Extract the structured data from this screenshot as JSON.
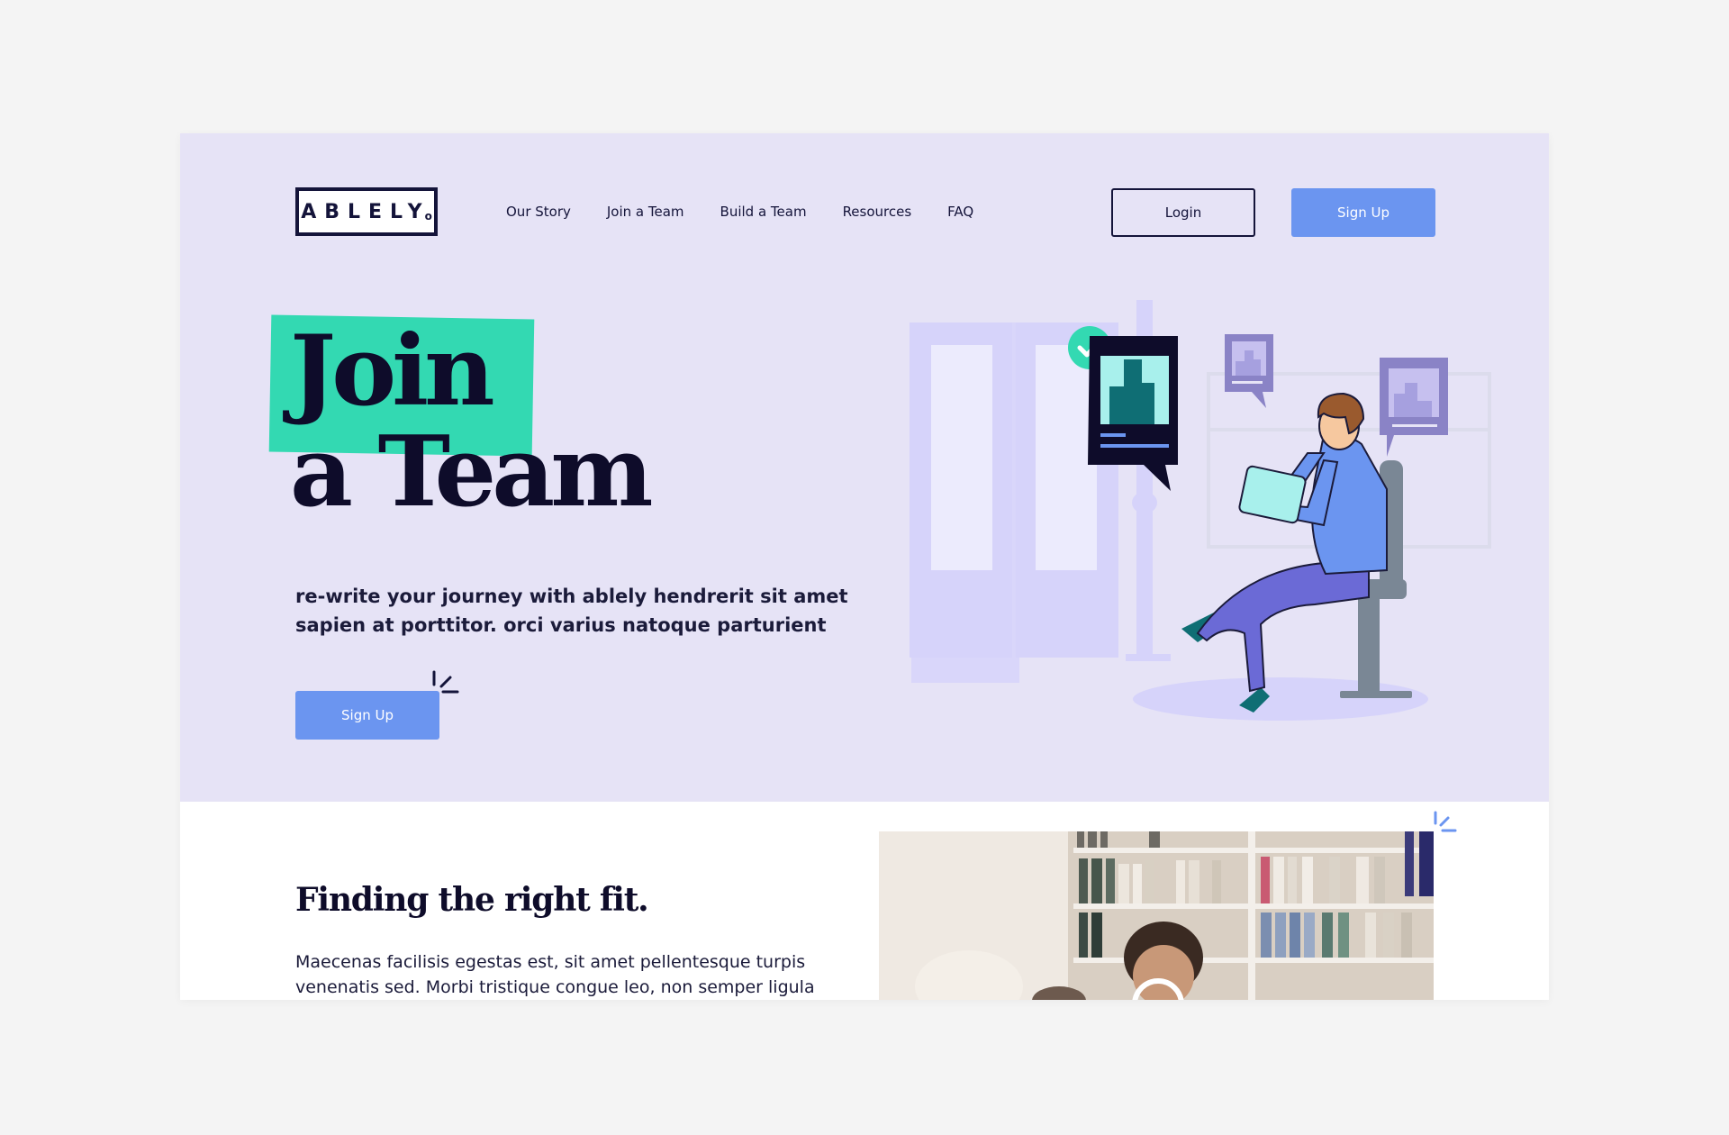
{
  "brand": {
    "logo_text": "ABLELY",
    "logo_mark": "o"
  },
  "nav": {
    "items": [
      {
        "label": "Our Story"
      },
      {
        "label": "Join a Team"
      },
      {
        "label": "Build a Team"
      },
      {
        "label": "Resources"
      },
      {
        "label": "FAQ"
      }
    ],
    "login_label": "Login",
    "signup_label": "Sign Up"
  },
  "hero": {
    "headline_line1": "Join",
    "headline_line2": "a Team",
    "subtitle": "re-write your journey with ablely hendrerit sit amet sapien at porttitor. orci varius natoque parturient",
    "cta_label": "Sign Up",
    "illustration_icons": [
      "window-icon",
      "check-icon",
      "chart-card-icon",
      "person-with-tablet-icon",
      "chair-icon"
    ]
  },
  "section": {
    "title": "Finding the right fit.",
    "body": "Maecenas facilisis egestas est, sit amet pellentesque turpis venenatis sed. Morbi tristique congue leo, non semper ligula",
    "photo_icon": "library-photo"
  },
  "colors": {
    "hero_bg": "#e6e3f6",
    "accent_green": "#33d9b2",
    "button_blue": "#6b95f0",
    "ink": "#0e0c2a"
  }
}
